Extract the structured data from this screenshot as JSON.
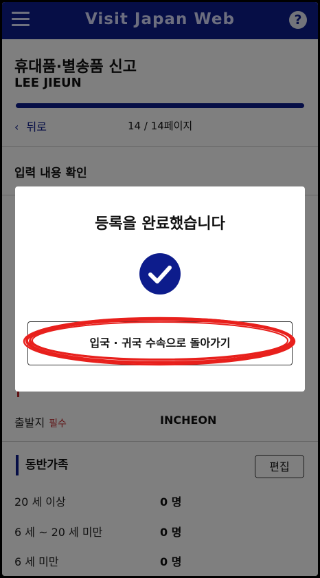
{
  "header": {
    "title": "Visit Japan Web",
    "menu_icon": "hamburger-menu-icon",
    "help_icon": "question-icon",
    "help_glyph": "?"
  },
  "form": {
    "title": "휴대품·별송품 신고",
    "name": "LEE JIEUN",
    "progress": 1.0,
    "back_label": "뒤로",
    "page_indicator": "14 / 14페이지",
    "section_title": "입력 내용 확인"
  },
  "departure": {
    "label": "출발지",
    "required": "필수",
    "value": "INCHEON"
  },
  "companions": {
    "title": "동반가족",
    "edit_label": "편집",
    "rows": [
      {
        "label": "20 세 이상",
        "value": "0 명"
      },
      {
        "label": "6 세 ~ 20 세 미만",
        "value": "0 명"
      },
      {
        "label": "6 세 미만",
        "value": "0 명"
      }
    ]
  },
  "modal": {
    "title": "등록을 완료했습니다",
    "button_label": "입국 · 귀국 수속으로 돌아가기",
    "icon": "checkmark-circle-icon"
  },
  "colors": {
    "brand": "#0d1c8c",
    "required": "#c0262a",
    "scribble": "#e8201c"
  }
}
